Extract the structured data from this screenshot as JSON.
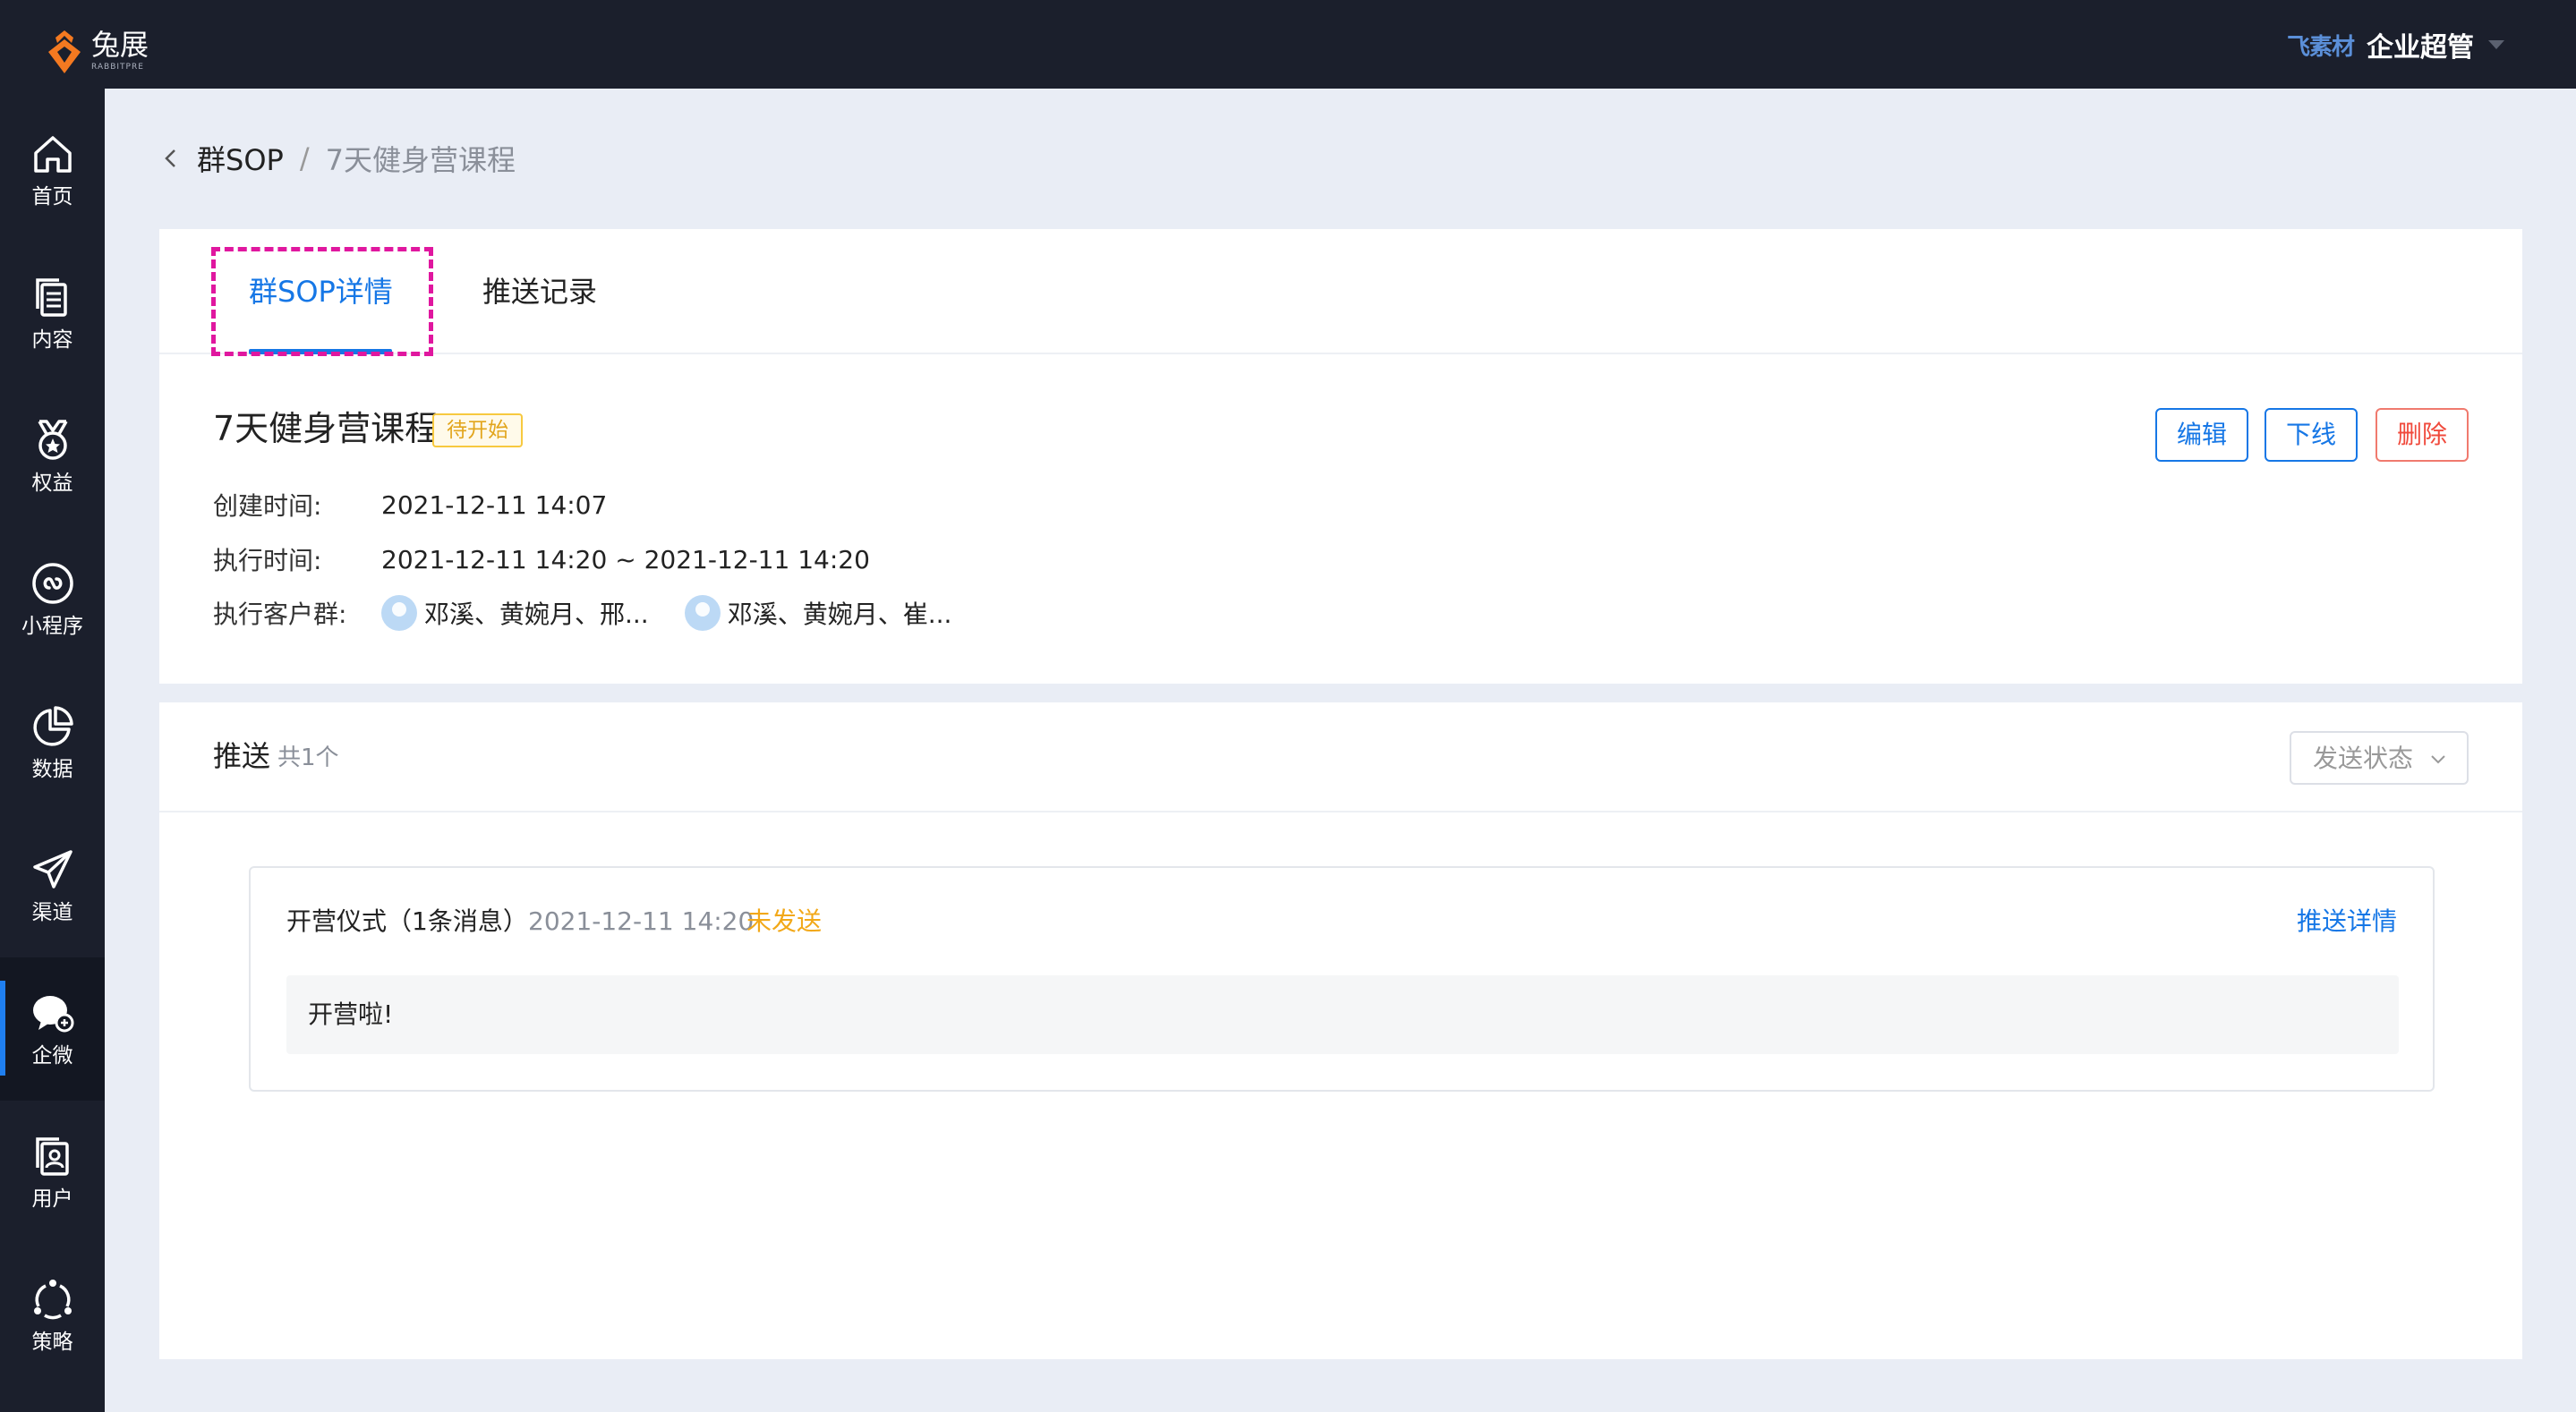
{
  "brand": {
    "name": "兔展",
    "sub": "RABBITPRE"
  },
  "topbar": {
    "org": "飞素材",
    "user": "企业超管"
  },
  "sidebar": {
    "items": [
      {
        "id": "home",
        "label": "首页",
        "icon": "home-icon"
      },
      {
        "id": "content",
        "label": "内容",
        "icon": "documents-icon"
      },
      {
        "id": "rights",
        "label": "权益",
        "icon": "medal-icon"
      },
      {
        "id": "miniapp",
        "label": "小程序",
        "icon": "link-icon"
      },
      {
        "id": "data",
        "label": "数据",
        "icon": "pie-chart-icon"
      },
      {
        "id": "channel",
        "label": "渠道",
        "icon": "send-icon"
      },
      {
        "id": "wecom",
        "label": "企微",
        "icon": "chat-icon",
        "active": true
      },
      {
        "id": "users",
        "label": "用户",
        "icon": "user-card-icon"
      },
      {
        "id": "strategy",
        "label": "策略",
        "icon": "cycle-icon"
      }
    ]
  },
  "breadcrumb": {
    "parent": "群SOP",
    "separator": "/",
    "current": "7天健身营课程"
  },
  "tabs": [
    {
      "label": "群SOP详情",
      "active": true
    },
    {
      "label": "推送记录",
      "active": false
    }
  ],
  "sop": {
    "title": "7天健身营课程",
    "status": "待开始",
    "actions": {
      "edit": "编辑",
      "offline": "下线",
      "delete": "删除"
    },
    "created_label": "创建时间:",
    "created": "2021-12-11 14:07",
    "exec_label": "执行时间:",
    "exec_time": "2021-12-11 14:20 ~ 2021-12-11 14:20",
    "groups_label": "执行客户群:",
    "groups": [
      "邓溪、黄婉月、邢...",
      "邓溪、黄婉月、崔..."
    ]
  },
  "push": {
    "title": "推送",
    "count": "共1个",
    "status_filter": "发送状态",
    "items": [
      {
        "title": "开营仪式（1条消息）",
        "time": "2021-12-11 14:20",
        "status": "未发送",
        "link": "推送详情",
        "content": "开营啦!"
      }
    ]
  },
  "colors": {
    "accent": "#1677e6",
    "danger": "#f04a3c",
    "warning": "#f2a818",
    "sidebar": "#1b1f2c"
  }
}
